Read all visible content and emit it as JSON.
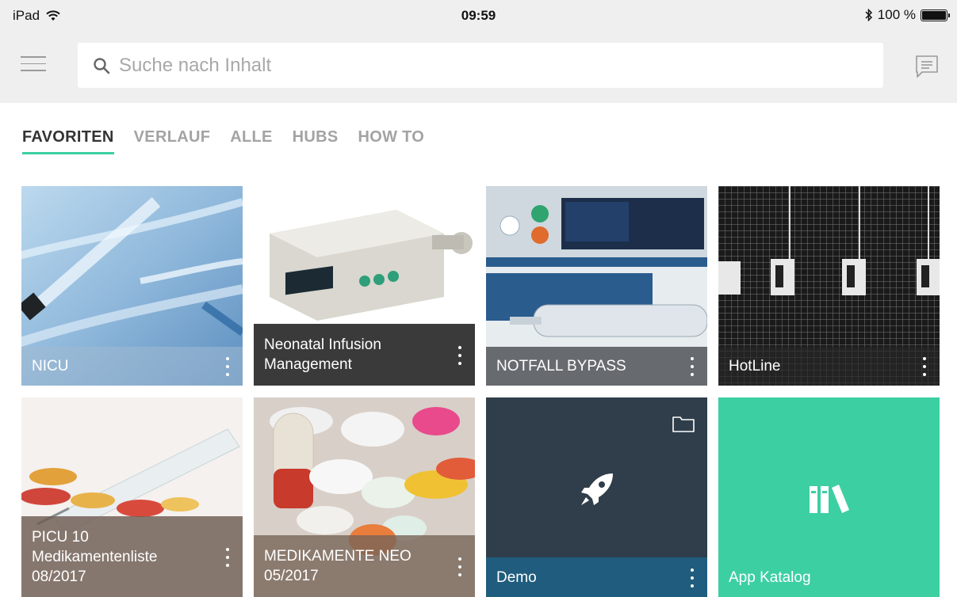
{
  "status_bar": {
    "device": "iPad",
    "time": "09:59",
    "battery": "100 %"
  },
  "search": {
    "placeholder": "Suche nach Inhalt",
    "value": ""
  },
  "tabs": [
    {
      "label": "FAVORITEN",
      "active": true
    },
    {
      "label": "VERLAUF",
      "active": false
    },
    {
      "label": "ALLE",
      "active": false
    },
    {
      "label": "HUBS",
      "active": false
    },
    {
      "label": "HOW TO",
      "active": false
    }
  ],
  "tiles": [
    {
      "title": "NICU",
      "kind": "image"
    },
    {
      "title": "Neonatal Infusion Management",
      "kind": "image"
    },
    {
      "title": "NOTFALL BYPASS",
      "kind": "image"
    },
    {
      "title": "HotLine",
      "kind": "image"
    },
    {
      "title": "PICU 10 Medikamentenliste 08/2017",
      "kind": "image"
    },
    {
      "title": "MEDIKAMENTE NEO 05/2017",
      "kind": "image"
    },
    {
      "title": "Demo",
      "kind": "hub",
      "icon": "rocket-icon",
      "color": "#2f3e4a",
      "caption_color": "#1f5c7d"
    },
    {
      "title": "App Katalog",
      "kind": "app",
      "icon": "books-icon",
      "color": "#3ccfa2"
    }
  ],
  "colors": {
    "accent": "#3ccfa2",
    "bar_bg": "#efefef"
  }
}
